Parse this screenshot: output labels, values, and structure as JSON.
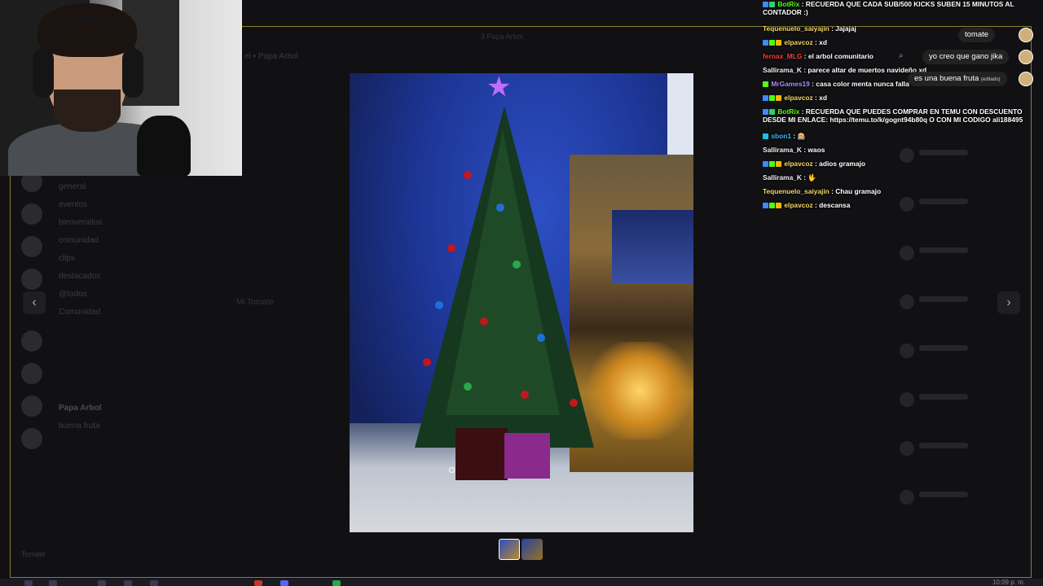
{
  "window": {
    "title": "Papa Arbol"
  },
  "background_ui": {
    "header_label": "el • Papa Arbol",
    "tab_label": "3 Papa Arbol",
    "channels": [
      "general",
      "eventos",
      "bienvenidos",
      "comunidad",
      "clips",
      "destacados",
      "@todos",
      "Comunidad",
      "Papa Arbol",
      "buena fruta"
    ],
    "message_author": "Mi Tomate",
    "user_name": "Tomate"
  },
  "viewer": {
    "prev_icon": "‹",
    "next_icon": "›",
    "thumbnail_count": 2
  },
  "chat": {
    "messages": [
      {
        "user": "BotRix",
        "text": "RECUERDA QUE CADA SUB/500 KICKS SUBEN 15 MINUTOS AL CONTADOR :)"
      },
      {
        "user": "Tequenuelo_saiyajin",
        "text": "Jajajaj"
      },
      {
        "user": "elpavcoz",
        "text": "xd"
      },
      {
        "user": "fernax_MLG",
        "text": "el arbol comunitario"
      },
      {
        "user": "Sallirama_K",
        "text": "parece altar de muertos navideño xd"
      },
      {
        "user": "MrGames19",
        "text": "casa color menta nunca falla"
      },
      {
        "user": "elpavcoz",
        "text": "xd"
      },
      {
        "user": "BotRix",
        "text": "RECUERDA QUE PUEDES COMPRAR EN TEMU CON DESCUENTO DESDE MI ENLACE: https://temu.to/k/gognt94b80q O CON MI CODIGO ali188495"
      },
      {
        "user": "sbon1",
        "text": "🎰"
      },
      {
        "user": "Sallirama_K",
        "text": "waos"
      },
      {
        "user": "elpavcoz",
        "text": "adios gramajo"
      },
      {
        "user": "Sallirama_K",
        "text": "🖖"
      },
      {
        "user": "Tequenuelo_saiyajin",
        "text": "Chau gramajo"
      },
      {
        "user": "elpavcoz",
        "text": "descansa"
      }
    ],
    "separator": " : "
  },
  "bubbles": {
    "tomate": "tomate",
    "jika": "yo creo que gano jika",
    "fruta": "es una buena fruta",
    "fruta_sub": "(editado)"
  },
  "taskbar": {
    "time": "10:09 p. m."
  }
}
